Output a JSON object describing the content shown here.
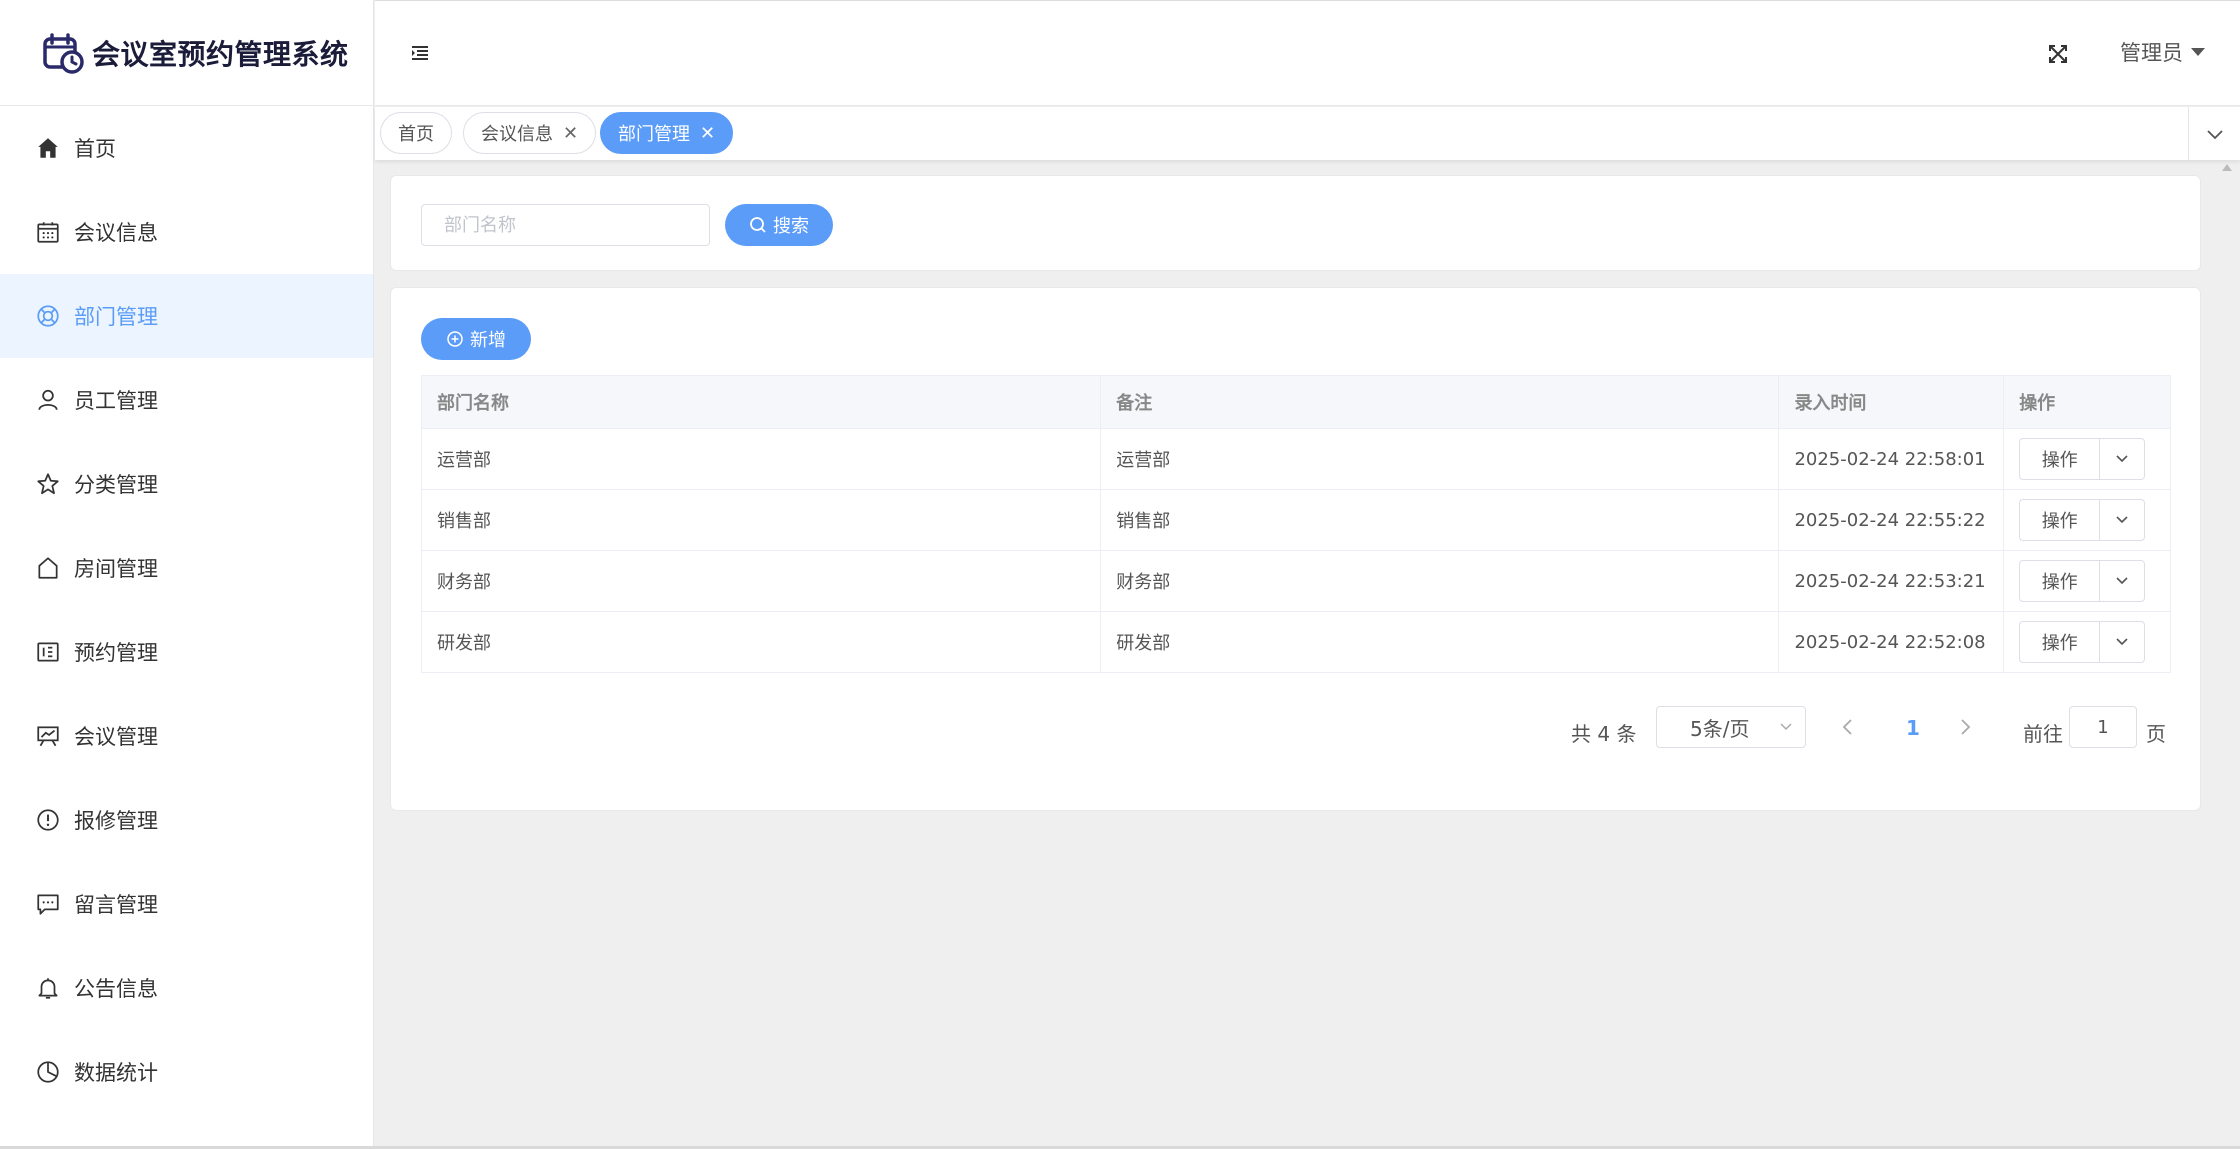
{
  "app": {
    "title": "会议室预约管理系统"
  },
  "sidebar": {
    "items": [
      {
        "label": "首页",
        "icon": "home-icon"
      },
      {
        "label": "会议信息",
        "icon": "calendar-icon"
      },
      {
        "label": "部门管理",
        "icon": "lifebuoy-icon"
      },
      {
        "label": "员工管理",
        "icon": "user-icon"
      },
      {
        "label": "分类管理",
        "icon": "star-icon"
      },
      {
        "label": "房间管理",
        "icon": "house-icon"
      },
      {
        "label": "预约管理",
        "icon": "schedule-icon"
      },
      {
        "label": "会议管理",
        "icon": "presentation-icon"
      },
      {
        "label": "报修管理",
        "icon": "warning-icon"
      },
      {
        "label": "留言管理",
        "icon": "message-icon"
      },
      {
        "label": "公告信息",
        "icon": "bell-icon"
      },
      {
        "label": "数据统计",
        "icon": "pie-chart-icon"
      }
    ],
    "active_index": 2
  },
  "header": {
    "user_name": "管理员"
  },
  "tabs": [
    {
      "label": "首页"
    },
    {
      "label": "会议信息"
    },
    {
      "label": "部门管理"
    }
  ],
  "search": {
    "placeholder": "部门名称",
    "value": "",
    "button_label": "搜索"
  },
  "toolbar": {
    "add_label": "新增"
  },
  "table": {
    "columns": [
      "部门名称",
      "备注",
      "录入时间",
      "操作"
    ],
    "rows": [
      {
        "name": "运营部",
        "note": "运营部",
        "time": "2025-02-24 22:58:01",
        "action": "操作"
      },
      {
        "name": "销售部",
        "note": "销售部",
        "time": "2025-02-24 22:55:22",
        "action": "操作"
      },
      {
        "name": "财务部",
        "note": "财务部",
        "time": "2025-02-24 22:53:21",
        "action": "操作"
      },
      {
        "name": "研发部",
        "note": "研发部",
        "time": "2025-02-24 22:52:08",
        "action": "操作"
      }
    ]
  },
  "pagination": {
    "total_text": "共 4 条",
    "page_size": "5条/页",
    "current_page": "1",
    "goto_prefix": "前往",
    "goto_value": "1",
    "goto_suffix": "页"
  },
  "colors": {
    "primary": "#5b9cf8",
    "active_bg": "#ecf5ff",
    "background": "#efefef"
  }
}
